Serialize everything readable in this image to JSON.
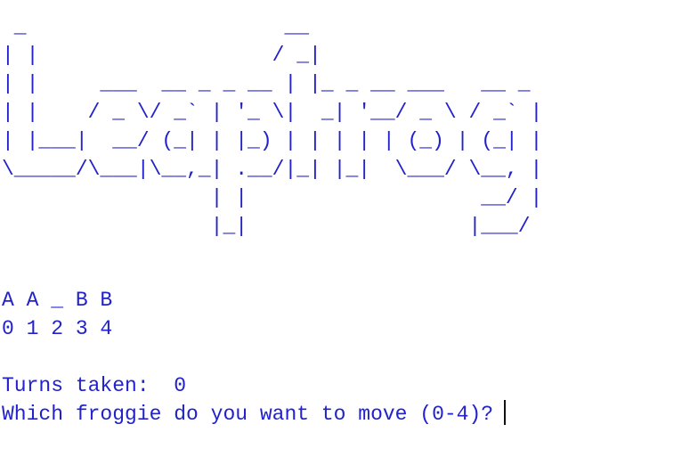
{
  "terminal": {
    "text_color": "#2222cc",
    "background_color": "#ffffff",
    "cursor_color": "#111111"
  },
  "banner": {
    "logo_text": "Leapfrog",
    "ascii_lines": [
      " _                     __",
      "| |                   / _|",
      "| |     ___  __ _ _ __ | |_ _ __ ___   __ _",
      "| |    / _ \\/ _` | '_ \\|  _| '__/ _ \\ / _` |",
      "| |___|  __/ (_| | |_) | | | | | (_) | (_| |",
      "\\_____/\\___|\\__,_| .__/|_| |_|  \\___/ \\__, |",
      "                 | |                   __/ |",
      "                 |_|                  |___/"
    ]
  },
  "board": {
    "labels": "A A _ B B",
    "positions": "0 1 2 3 4"
  },
  "status": {
    "turns_label": "Turns taken:",
    "turns_value": "0"
  },
  "prompt": {
    "text": "Which froggie do you want to move (0-4)?"
  }
}
